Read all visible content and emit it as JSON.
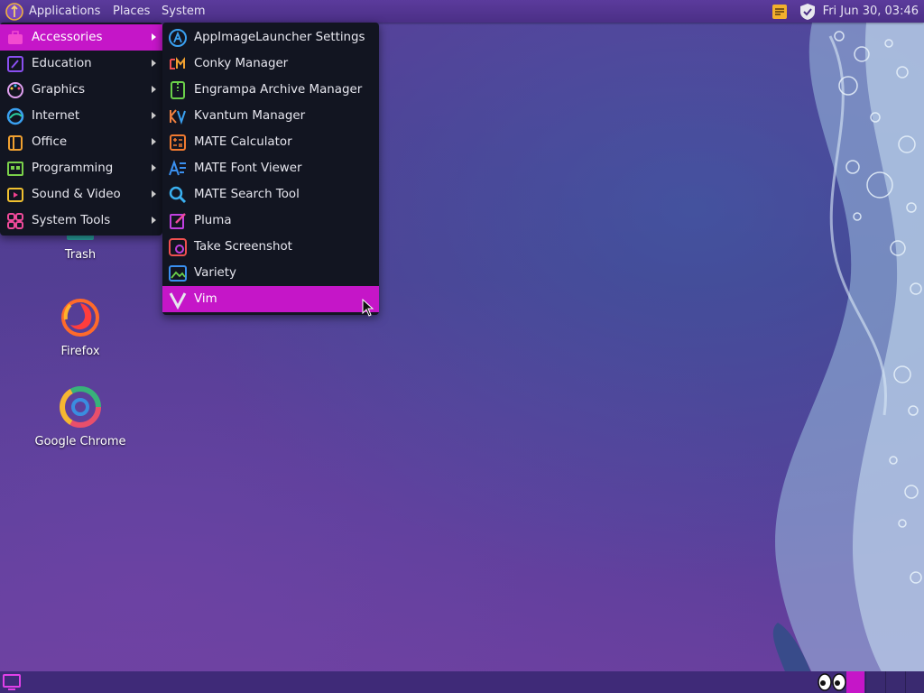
{
  "colors": {
    "accent": "#c516c8",
    "menu_bg": "#121521",
    "panel_bg": "#4b2f86"
  },
  "top_panel": {
    "applications_label": "Applications",
    "places_label": "Places",
    "system_label": "System",
    "clock": "Fri Jun 30, 03:46"
  },
  "desktop": {
    "icons": [
      {
        "label": "Trash",
        "icon": "trash-icon"
      },
      {
        "label": "Firefox",
        "icon": "firefox-icon"
      },
      {
        "label": "Google Chrome",
        "icon": "chrome-icon"
      }
    ]
  },
  "categories": [
    {
      "label": "Accessories",
      "icon": "accessories-icon",
      "selected": true
    },
    {
      "label": "Education",
      "icon": "education-icon"
    },
    {
      "label": "Graphics",
      "icon": "graphics-icon"
    },
    {
      "label": "Internet",
      "icon": "internet-icon"
    },
    {
      "label": "Office",
      "icon": "office-icon"
    },
    {
      "label": "Programming",
      "icon": "programming-icon"
    },
    {
      "label": "Sound & Video",
      "icon": "sound-video-icon"
    },
    {
      "label": "System Tools",
      "icon": "system-tools-icon"
    }
  ],
  "accessories": [
    {
      "label": "AppImageLauncher Settings",
      "icon": "appimagelauncher-icon"
    },
    {
      "label": "Conky Manager",
      "icon": "conky-icon"
    },
    {
      "label": "Engrampa Archive Manager",
      "icon": "archive-icon"
    },
    {
      "label": "Kvantum Manager",
      "icon": "kvantum-icon"
    },
    {
      "label": "MATE Calculator",
      "icon": "calculator-icon"
    },
    {
      "label": "MATE Font Viewer",
      "icon": "font-viewer-icon"
    },
    {
      "label": "MATE Search Tool",
      "icon": "search-icon"
    },
    {
      "label": "Pluma",
      "icon": "pluma-icon"
    },
    {
      "label": "Take Screenshot",
      "icon": "screenshot-icon"
    },
    {
      "label": "Variety",
      "icon": "variety-icon"
    },
    {
      "label": "Vim",
      "icon": "vim-icon",
      "selected": true
    }
  ]
}
